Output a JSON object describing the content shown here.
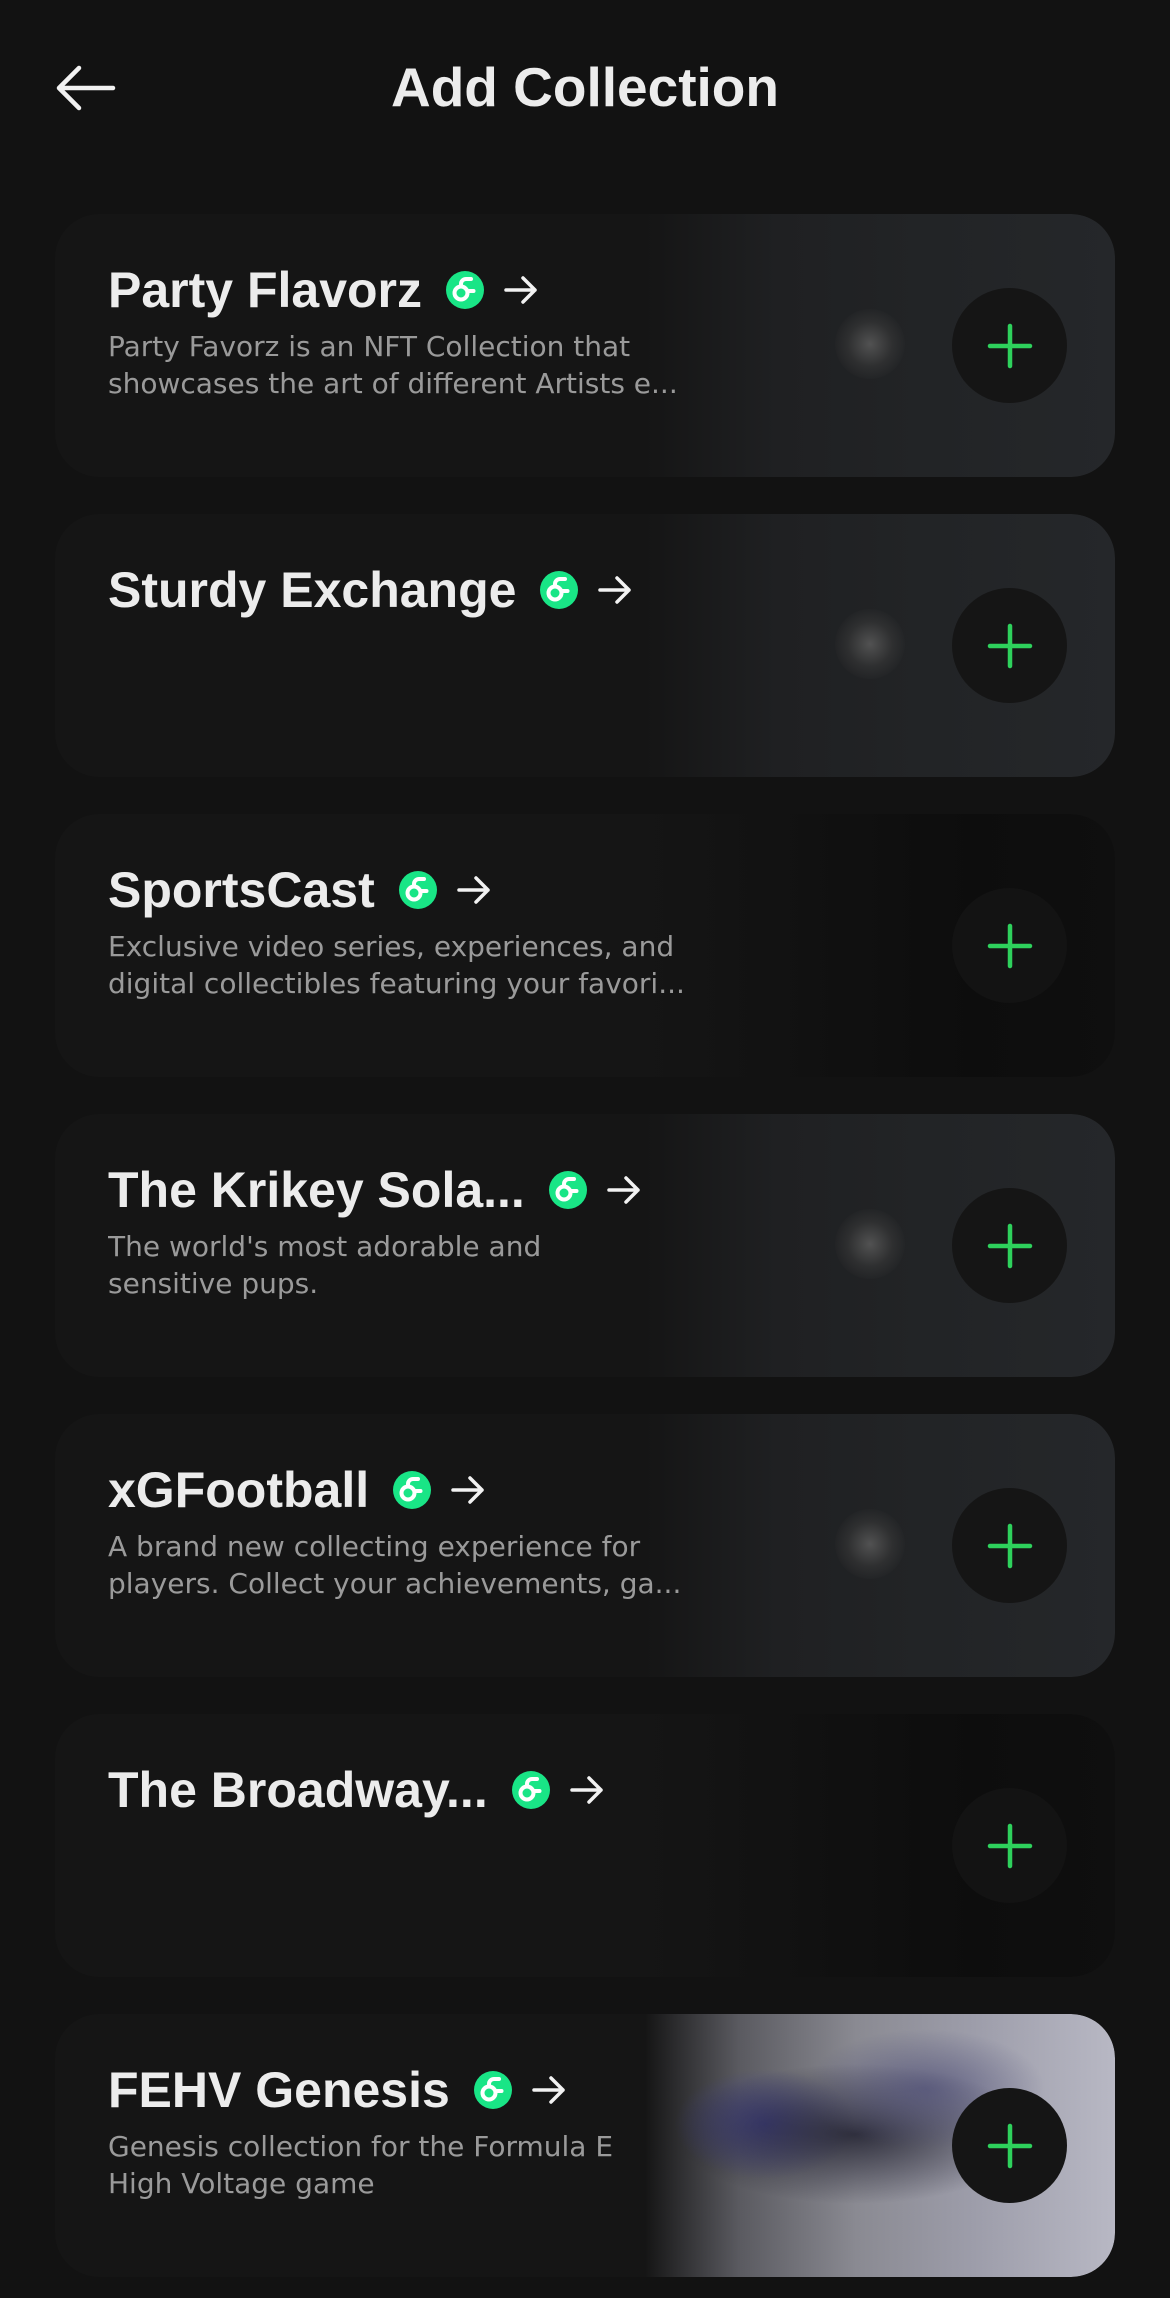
{
  "header": {
    "title": "Add Collection",
    "back_icon": "arrow-left-icon"
  },
  "colors": {
    "background": "#121212",
    "accent": "#2ed15c",
    "verified_badge": "#19e586"
  },
  "collections": [
    {
      "title": "Party Flavorz",
      "description_line1": "Party Favorz is an NFT Collection that",
      "description_line2": "showcases the art of different Artists e...",
      "thumbnail": "gray"
    },
    {
      "title": "Sturdy Exchange",
      "description_line1": "",
      "description_line2": "",
      "thumbnail": "gray"
    },
    {
      "title": "SportsCast",
      "description_line1": "Exclusive video series, experiences, and",
      "description_line2": "digital collectibles featuring your favori...",
      "thumbnail": "dark"
    },
    {
      "title": "The Krikey Sola...",
      "description_line1": "The world's most adorable and",
      "description_line2": "sensitive pups.",
      "thumbnail": "gray"
    },
    {
      "title": "xGFootball",
      "description_line1": "A brand new collecting experience for",
      "description_line2": "players. Collect your achievements, ga...",
      "thumbnail": "gray"
    },
    {
      "title": "The Broadway...",
      "description_line1": "",
      "description_line2": "",
      "thumbnail": "dark"
    },
    {
      "title": "FEHV Genesis",
      "description_line1": "Genesis collection for the Formula E",
      "description_line2": "High Voltage game",
      "thumbnail": "photo"
    }
  ]
}
